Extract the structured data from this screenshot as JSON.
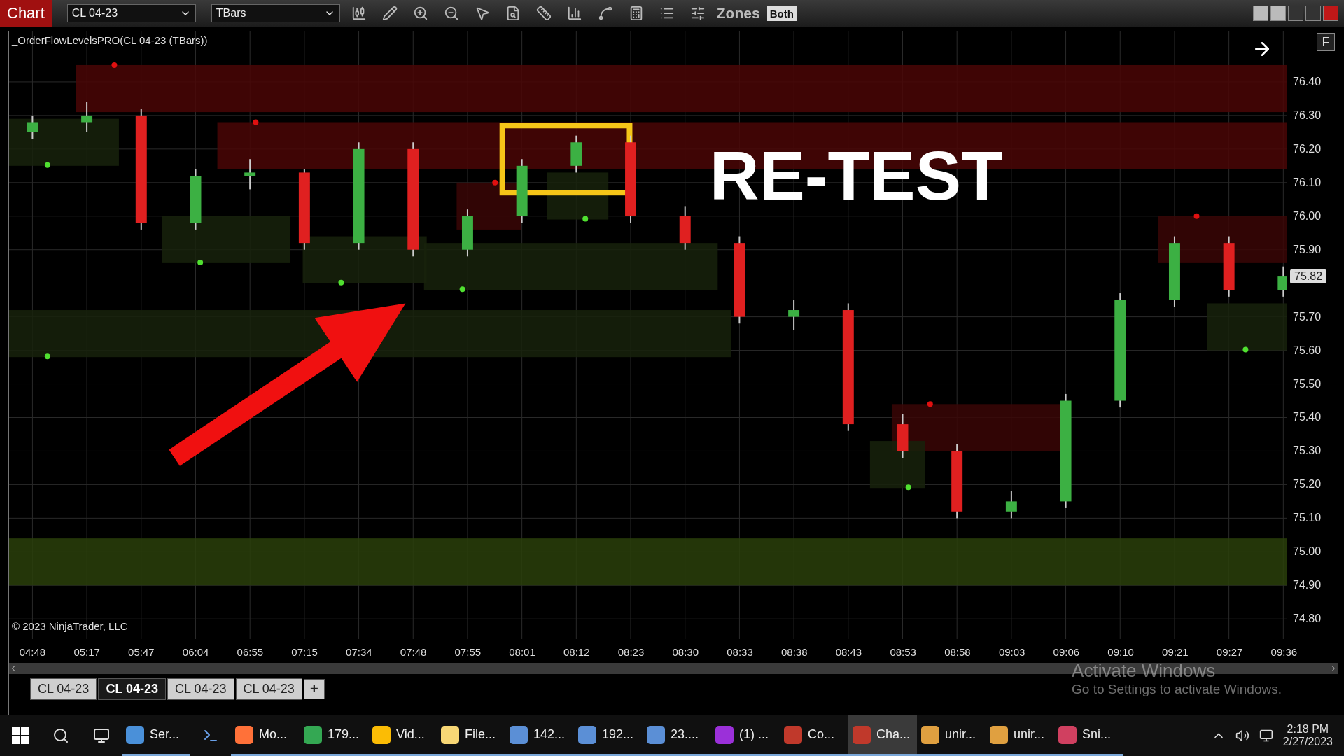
{
  "toolbar": {
    "title": "Chart",
    "instrument": "CL 04-23",
    "bar_type": "TBars",
    "zones_label": "Zones",
    "zones_mode": "Both"
  },
  "chart": {
    "indicator_title": "_OrderFlowLevelsPRO(CL 04-23 (TBars))",
    "copyright": "© 2023 NinjaTrader, LLC",
    "side_button": "F",
    "last_price": "75.82",
    "chart_data": {
      "type": "candlestick",
      "categories": [
        "04:48",
        "05:17",
        "05:47",
        "06:04",
        "06:55",
        "07:15",
        "07:34",
        "07:48",
        "07:55",
        "08:01",
        "08:12",
        "08:23",
        "08:30",
        "08:33",
        "08:38",
        "08:43",
        "08:53",
        "08:58",
        "09:03",
        "09:06",
        "09:10",
        "09:21",
        "09:27",
        "09:36"
      ],
      "ohlc": [
        [
          76.25,
          76.3,
          76.23,
          76.28
        ],
        [
          76.28,
          76.34,
          76.25,
          76.3
        ],
        [
          76.3,
          76.32,
          75.96,
          75.98
        ],
        [
          75.98,
          76.14,
          75.96,
          76.12
        ],
        [
          76.12,
          76.17,
          76.08,
          76.13
        ],
        [
          76.13,
          76.14,
          75.9,
          75.92
        ],
        [
          75.92,
          76.22,
          75.9,
          76.2
        ],
        [
          76.2,
          76.22,
          75.88,
          75.9
        ],
        [
          75.9,
          76.02,
          75.88,
          76.0
        ],
        [
          76.0,
          76.17,
          75.98,
          76.15
        ],
        [
          76.15,
          76.24,
          76.13,
          76.22
        ],
        [
          76.22,
          76.24,
          75.98,
          76.0
        ],
        [
          76.0,
          76.03,
          75.9,
          75.92
        ],
        [
          75.92,
          75.94,
          75.68,
          75.7
        ],
        [
          75.7,
          75.75,
          75.66,
          75.72
        ],
        [
          75.72,
          75.74,
          75.36,
          75.38
        ],
        [
          75.38,
          75.41,
          75.28,
          75.3
        ],
        [
          75.3,
          75.32,
          75.1,
          75.12
        ],
        [
          75.12,
          75.18,
          75.1,
          75.15
        ],
        [
          75.15,
          75.47,
          75.13,
          75.45
        ],
        [
          75.45,
          75.77,
          75.43,
          75.75
        ],
        [
          75.75,
          75.94,
          75.73,
          75.92
        ],
        [
          75.92,
          75.94,
          75.76,
          75.78
        ],
        [
          75.78,
          75.85,
          75.76,
          75.82
        ]
      ],
      "ylim": [
        74.74,
        76.55
      ],
      "grid": true,
      "yticks": [
        {
          "value": 76.4,
          "label": "76.40"
        },
        {
          "value": 76.3,
          "label": "76.30"
        },
        {
          "value": 76.2,
          "label": "76.20"
        },
        {
          "value": 76.1,
          "label": "76.10"
        },
        {
          "value": 76.0,
          "label": "76.00"
        },
        {
          "value": 75.9,
          "label": "75.90"
        },
        {
          "value": 75.7,
          "label": "75.70"
        },
        {
          "value": 75.6,
          "label": "75.60"
        },
        {
          "value": 75.5,
          "label": "75.50"
        },
        {
          "value": 75.4,
          "label": "75.40"
        },
        {
          "value": 75.3,
          "label": "75.30"
        },
        {
          "value": 75.2,
          "label": "75.20"
        },
        {
          "value": 75.1,
          "label": "75.10"
        },
        {
          "value": 75.0,
          "label": "75.00"
        },
        {
          "value": 74.9,
          "label": "74.90"
        },
        {
          "value": 74.8,
          "label": "74.80"
        }
      ],
      "bands": [
        {
          "axis": "y",
          "from": 76.31,
          "to": 76.45,
          "color": "#4a0606"
        },
        {
          "axis": "y",
          "from": 76.14,
          "to": 76.28,
          "color": "#4a0606"
        },
        {
          "axis": "y",
          "from": 75.86,
          "to": 76.0,
          "color": "#3a0606"
        },
        {
          "axis": "y",
          "from": 75.3,
          "to": 75.44,
          "color": "#3a0606"
        },
        {
          "axis": "y",
          "from": 75.96,
          "to": 76.1,
          "color": "#3a0606"
        },
        {
          "axis": "y",
          "from": 76.15,
          "to": 76.29,
          "color": "#17220c"
        },
        {
          "axis": "y",
          "from": 75.86,
          "to": 76.0,
          "color": "#17220c"
        },
        {
          "axis": "y",
          "from": 75.8,
          "to": 75.94,
          "color": "#17220c"
        },
        {
          "axis": "y",
          "from": 75.78,
          "to": 75.92,
          "color": "#17220c"
        },
        {
          "axis": "y",
          "from": 75.58,
          "to": 75.72,
          "color": "#17220c"
        },
        {
          "axis": "y",
          "from": 75.99,
          "to": 76.13,
          "color": "#17220c"
        },
        {
          "axis": "y",
          "from": 75.19,
          "to": 75.33,
          "color": "#17220c"
        },
        {
          "axis": "y",
          "from": 75.6,
          "to": 75.74,
          "color": "#17220c"
        },
        {
          "axis": "y",
          "from": 74.9,
          "to": 75.04,
          "color": "#2a3f0a"
        }
      ],
      "annotations": [
        "RE-TEST"
      ]
    }
  },
  "tabs": [
    {
      "label": "CL 04-23",
      "selected": false
    },
    {
      "label": "CL 04-23",
      "selected": true
    },
    {
      "label": "CL 04-23",
      "selected": false
    },
    {
      "label": "CL 04-23",
      "selected": false
    }
  ],
  "add_tab": "+",
  "activation_notice": {
    "title": "Activate Windows",
    "subtitle": "Go to Settings to activate Windows."
  },
  "taskbar": {
    "apps": [
      {
        "label": "Ser...",
        "color": "#4a90d9",
        "selected": false
      },
      {
        "label": "Mo...",
        "color": "#ff7139",
        "selected": false
      },
      {
        "label": "179...",
        "color": "#34a853",
        "selected": false
      },
      {
        "label": "Vid...",
        "color": "#fbbc05",
        "selected": false
      },
      {
        "label": "File...",
        "color": "#f8d775",
        "selected": false
      },
      {
        "label": "142...",
        "color": "#5b8fd6",
        "selected": false
      },
      {
        "label": "192...",
        "color": "#5b8fd6",
        "selected": false
      },
      {
        "label": "23....",
        "color": "#5b8fd6",
        "selected": false
      },
      {
        "label": "(1) ...",
        "color": "#9b30d9",
        "selected": false
      },
      {
        "label": "Co...",
        "color": "#c0392b",
        "selected": false
      },
      {
        "label": "Cha...",
        "color": "#c0392b",
        "selected": true
      },
      {
        "label": "unir...",
        "color": "#e0a040",
        "selected": false
      },
      {
        "label": "unir...",
        "color": "#e0a040",
        "selected": false
      },
      {
        "label": "Sni...",
        "color": "#d04060",
        "selected": false
      }
    ],
    "time": "2:18 PM",
    "date": "2/27/2023"
  }
}
